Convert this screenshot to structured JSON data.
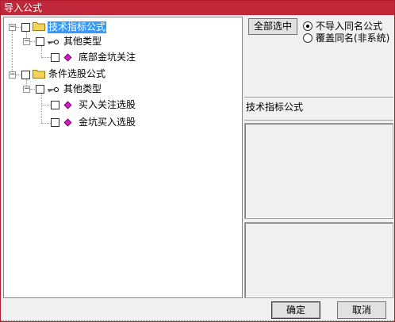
{
  "window": {
    "title": "导入公式"
  },
  "tree": {
    "groups": [
      {
        "label": "技术指标公式",
        "selected": true,
        "children": [
          {
            "label": "其他类型",
            "children": [
              {
                "label": "底部金坑关注"
              }
            ]
          }
        ]
      },
      {
        "label": "条件选股公式",
        "selected": false,
        "children": [
          {
            "label": "其他类型",
            "children": [
              {
                "label": "买入关注选股"
              },
              {
                "label": "金坑买入选股"
              }
            ]
          }
        ]
      }
    ]
  },
  "right_panel": {
    "select_all_label": "全部选中",
    "radio_options": [
      {
        "label": "不导入同名公式",
        "checked": true
      },
      {
        "label": "覆盖同名(非系统)",
        "checked": false
      }
    ],
    "formula_name": "技术指标公式"
  },
  "footer": {
    "ok_label": "确定",
    "cancel_label": "取消"
  },
  "colors": {
    "titlebar": "#c0283a",
    "selection": "#3399ff",
    "formula_diamond": "#d020c0",
    "folder": "#f3d35a"
  }
}
